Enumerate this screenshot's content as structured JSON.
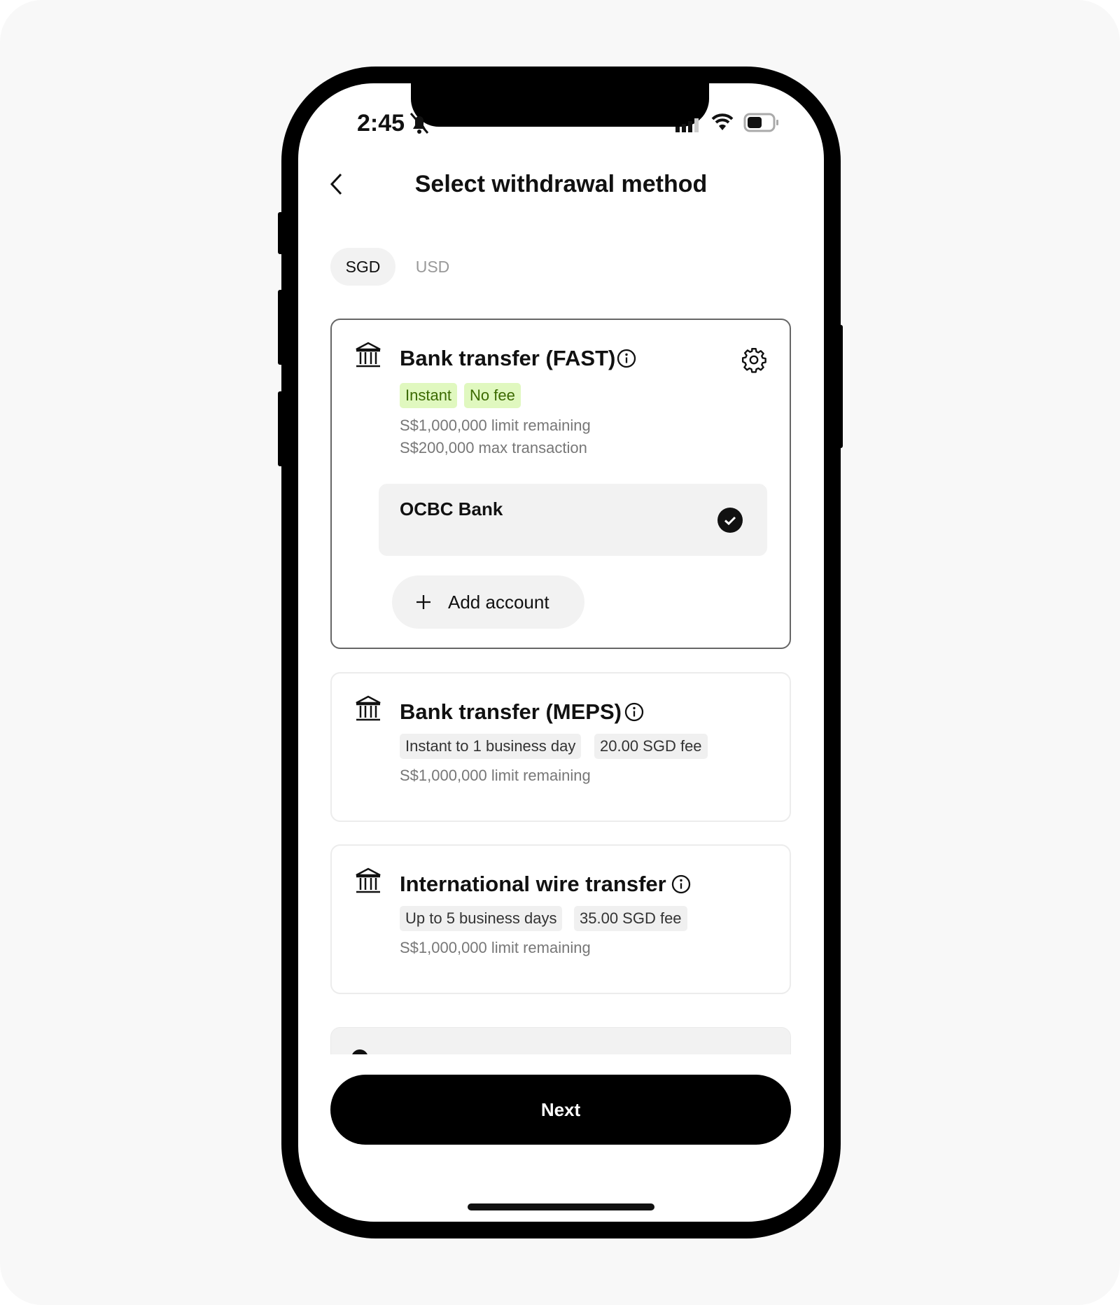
{
  "status": {
    "time": "2:45"
  },
  "header": {
    "title": "Select withdrawal method"
  },
  "tabs": [
    {
      "label": "SGD",
      "selected": true
    },
    {
      "label": "USD",
      "selected": false
    }
  ],
  "methods": [
    {
      "title": "Bank transfer (FAST)",
      "badges": [
        "Instant",
        "No fee"
      ],
      "lines": [
        "S$1,000,000 limit remaining",
        "S$200,000 max transaction"
      ],
      "selected": true,
      "account": {
        "name": "OCBC Bank",
        "selected": true
      },
      "add_account_label": "Add account"
    },
    {
      "title": "Bank transfer (MEPS)",
      "badges": [
        "Instant to 1 business day",
        "20.00 SGD fee"
      ],
      "lines": [
        "S$1,000,000 limit remaining"
      ]
    },
    {
      "title": "International wire transfer",
      "badges": [
        "Up to 5 business days",
        "35.00 SGD fee"
      ],
      "lines": [
        "S$1,000,000 limit remaining"
      ]
    }
  ],
  "next_label": "Next",
  "colors": {
    "accent": "#000000",
    "badge_green_bg": "#e0f8bf",
    "badge_green_text": "#3b6a00",
    "badge_grey_bg": "#f0f0f0"
  }
}
